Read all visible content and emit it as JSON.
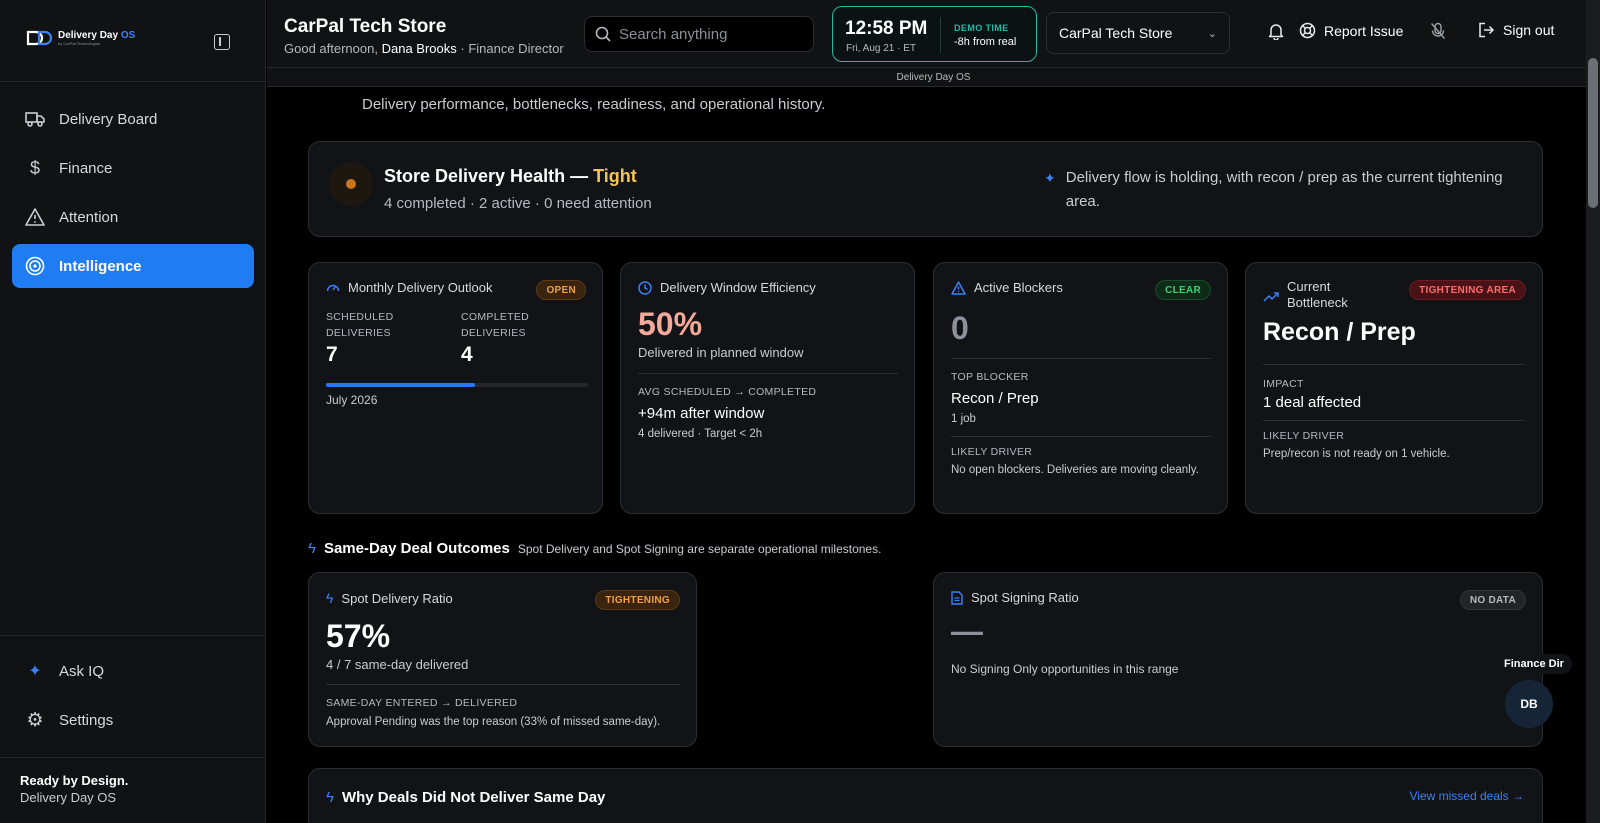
{
  "brand": {
    "name": "Delivery Day",
    "name_accent": "OS",
    "tagline": "by CarPal Technologies"
  },
  "sidebar": {
    "items": [
      {
        "label": "Delivery Board",
        "icon": "truck-icon"
      },
      {
        "label": "Finance",
        "icon": "dollar-icon"
      },
      {
        "label": "Attention",
        "icon": "warning-icon"
      },
      {
        "label": "Intelligence",
        "icon": "target-icon",
        "active": true
      }
    ],
    "bottom_items": [
      {
        "label": "Ask IQ",
        "icon": "sparkle-icon"
      },
      {
        "label": "Settings",
        "icon": "gear-icon"
      }
    ],
    "footer": {
      "line1": "Ready by Design.",
      "line2": "Delivery Day OS"
    }
  },
  "header": {
    "store_title": "CarPal Tech Store",
    "greeting_prefix": "Good afternoon,",
    "user_name": "Dana Brooks",
    "user_role": "· Finance Director",
    "search_placeholder": "Search anything",
    "clock": {
      "time": "12:58 PM",
      "date": "Fri, Aug 21 · ET",
      "label": "DEMO TIME",
      "offset": "-8h from real"
    },
    "store_select": "CarPal Tech Store",
    "report_label": "Report Issue",
    "signout_label": "Sign out",
    "subbar": "Delivery Day OS"
  },
  "page": {
    "subtitle": "Delivery performance, bottlenecks, readiness, and operational history."
  },
  "health": {
    "title": "Store Delivery Health —",
    "status": "Tight",
    "summary": "4 completed · 2 active · 0 need attention",
    "note": "Delivery flow is holding, with recon / prep as the current tightening area."
  },
  "metrics": {
    "outlook": {
      "title": "Monthly Delivery Outlook",
      "badge": "OPEN",
      "scheduled_label": "SCHEDULED DELIVERIES",
      "scheduled": "7",
      "completed_label": "COMPLETED DELIVERIES",
      "completed": "4",
      "progress": 0.57,
      "month": "July 2026"
    },
    "efficiency": {
      "title": "Delivery Window Efficiency",
      "value": "50%",
      "desc": "Delivered in planned window",
      "avg_label": "AVG SCHEDULED → COMPLETED",
      "avg_value": "+94m after window",
      "avg_note": "4 delivered · Target < 2h"
    },
    "blockers": {
      "title": "Active Blockers",
      "badge": "CLEAR",
      "value": "0",
      "top_label": "TOP BLOCKER",
      "top_value": "Recon / Prep",
      "top_count": "1 job",
      "driver_label": "LIKELY DRIVER",
      "driver_value": "No open blockers. Deliveries are moving cleanly."
    },
    "bottleneck": {
      "title": "Current Bottleneck",
      "badge": "TIGHTENING AREA",
      "value": "Recon / Prep",
      "impact_label": "IMPACT",
      "impact_value": "1 deal affected",
      "driver_label": "LIKELY DRIVER",
      "driver_value": "Prep/recon is not ready on 1 vehicle."
    }
  },
  "same_day": {
    "title": "Same-Day Deal Outcomes",
    "note": "Spot Delivery and Spot Signing are separate operational milestones.",
    "spot_delivery": {
      "title": "Spot Delivery Ratio",
      "badge": "TIGHTENING",
      "value": "57%",
      "desc": "4 / 7 same-day delivered",
      "flow_label": "SAME-DAY ENTERED → DELIVERED",
      "flow_note": "Approval Pending was the top reason (33% of missed same-day)."
    },
    "spot_signing": {
      "title": "Spot Signing Ratio",
      "badge": "NO DATA",
      "value": "—",
      "desc": "No Signing Only opportunities in this range"
    }
  },
  "why": {
    "title": "Why Deals Did Not Deliver Same Day",
    "link": "View missed deals →"
  },
  "avatar": {
    "tag": "Finance Dir",
    "initials": "DB"
  },
  "colors": {
    "accent": "#1f7cf3",
    "teal": "#21b8a6",
    "status_tight": "#f5c451",
    "efficiency_value": "#f4a99a"
  }
}
